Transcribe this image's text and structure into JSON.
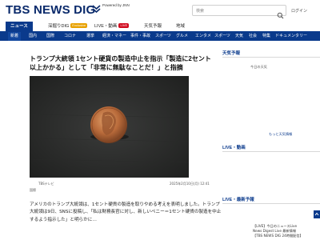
{
  "header": {
    "logo": "TBS NEWS DIG",
    "powered_by": "Powered by JNN",
    "search_placeholder": "検索",
    "login": "ログイン"
  },
  "tabs": [
    {
      "label": "ニュース",
      "active": true
    },
    {
      "label": "深掘りDIG",
      "badge": "Exclusive"
    },
    {
      "label": "LIVE・動画",
      "badge": "LIVE"
    },
    {
      "label": "天気予報"
    },
    {
      "label": "地域"
    }
  ],
  "categories": [
    "新着",
    "国内",
    "国際",
    "コロナ",
    "選挙",
    "経済・マネー",
    "事件・事故",
    "スポーツ",
    "グルメ",
    "エンタメ",
    "スポーツ",
    "天気",
    "社会",
    "特集",
    "ドキュメンタリー"
  ],
  "article": {
    "title": "トランプ大統領 1セント硬貨の製造中止を指示「製造に2セント以上かかる」として「非常に無駄なことだ！」と指摘",
    "photo_credit": "TBSテレビ",
    "date": "2025年2月10日(月) 12:41",
    "category": "国際",
    "body": "アメリカのトランプ大統領は、1セント硬貨の製造を取りやめる考えを表明しました。トランプ大統領は9日、SNSに投稿し、「私は財務長官に対し、新しいペニー＝1セント硬貨の製造を中止するよう指示した」と明らかに…"
  },
  "sidebar": {
    "weather_heading": "天気予報",
    "weather_text": "今日の天気",
    "more_weather": "もっと天気情報",
    "live_heading": "LIVE・動画",
    "latest_heading": "LIVE・最新予報",
    "video_lines": [
      "【LIVE】今日のニュースLive",
      "News Digest Live 最新情報",
      "【TBS NEWS DIG 24時間配信】"
    ]
  },
  "colors": {
    "brand": "#0a3a8c",
    "logo": "#0a2a6b",
    "badge_red": "#d10a1e"
  }
}
